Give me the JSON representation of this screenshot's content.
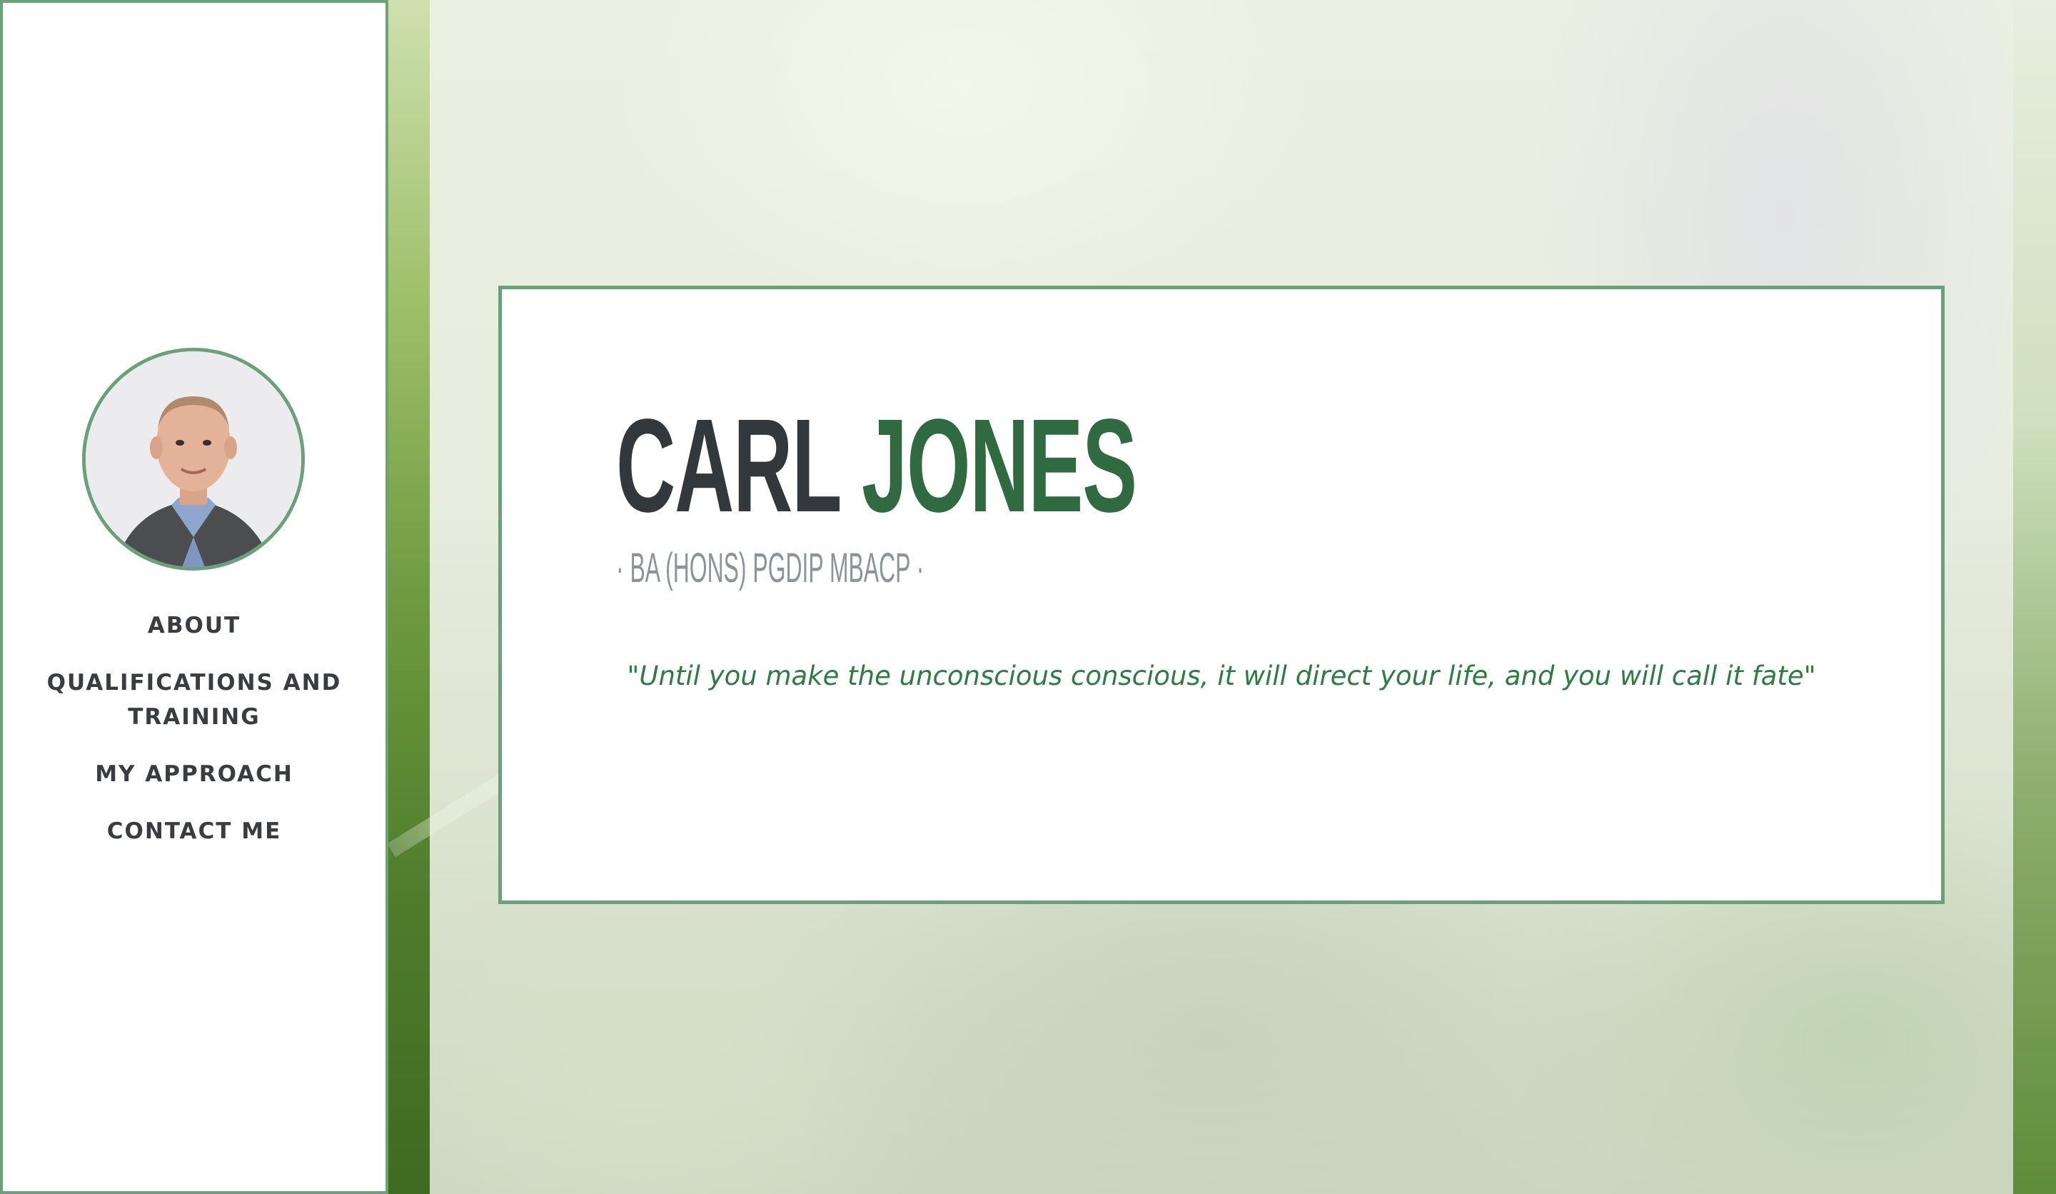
{
  "profile": {
    "first_name": "CARL",
    "last_name": "JONES",
    "credentials": "· BA (HONS) PGDIP MBACP ·",
    "quote": "\"Until you make the unconscious conscious, it will direct your life, and you will call it fate\""
  },
  "nav": {
    "items": [
      {
        "label": "ABOUT"
      },
      {
        "label": "QUALIFICATIONS AND TRAINING"
      },
      {
        "label": "MY APPROACH"
      },
      {
        "label": "CONTACT ME"
      }
    ]
  },
  "colors": {
    "accent_green": "#6aa07a",
    "name_green": "#2f6a40",
    "quote_green": "#2f7a45",
    "dark_text": "#33383c",
    "muted_text": "#8d9499"
  }
}
